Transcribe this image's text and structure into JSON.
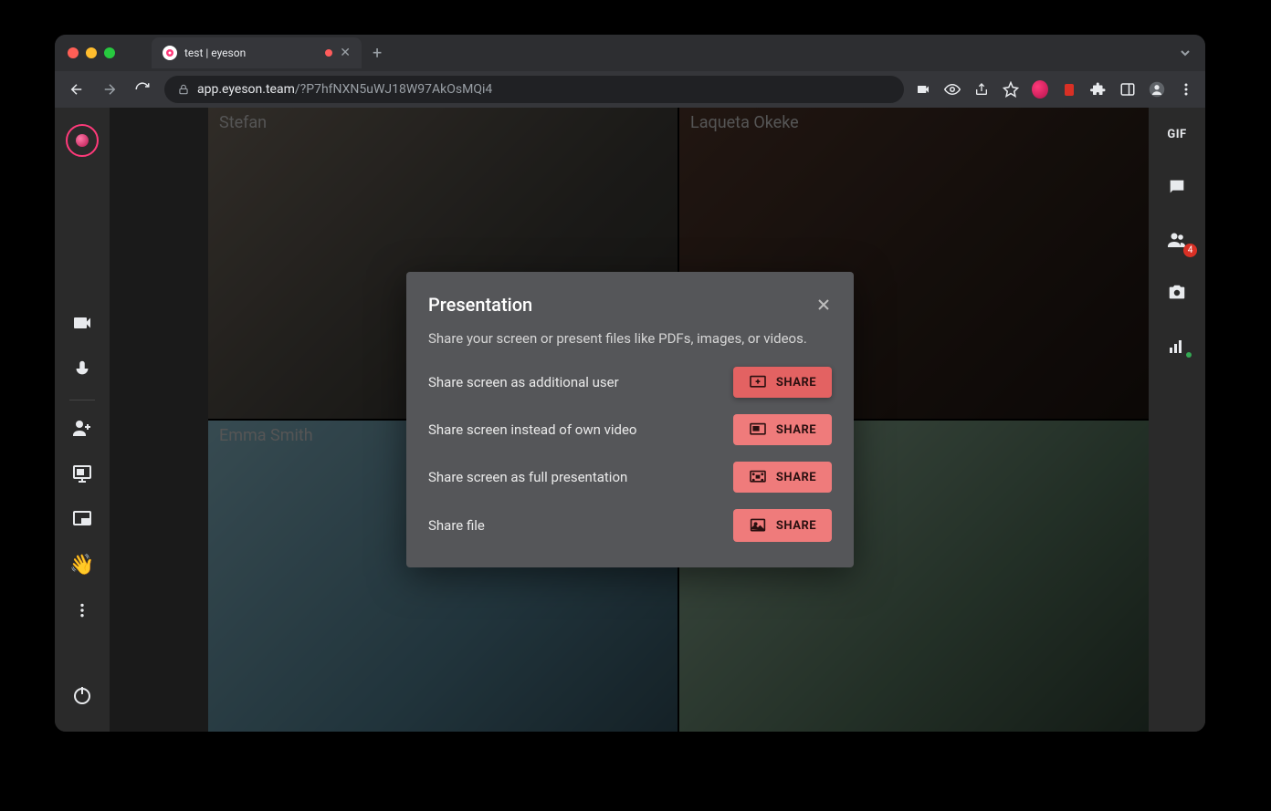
{
  "browser": {
    "tab_title": "test | eyeson",
    "url_display_host": "app.eyeson.team",
    "url_display_path": "/?P7hfNXN5uWJ18W97AkOsMQi4"
  },
  "participants": [
    {
      "name": "Stefan"
    },
    {
      "name": "Laqueta Okeke"
    },
    {
      "name": "Emma Smith"
    },
    {
      "name": ""
    }
  ],
  "right_rail": {
    "gif_label": "GIF",
    "participants_badge": "4"
  },
  "modal": {
    "title": "Presentation",
    "description": "Share your screen or present files like PDFs, images, or videos.",
    "rows": [
      {
        "label": "Share screen as additional user",
        "button": "SHARE",
        "primary": true
      },
      {
        "label": "Share screen instead of own video",
        "button": "SHARE",
        "primary": false
      },
      {
        "label": "Share screen as full presentation",
        "button": "SHARE",
        "primary": false
      },
      {
        "label": "Share file",
        "button": "SHARE",
        "primary": false
      }
    ]
  }
}
